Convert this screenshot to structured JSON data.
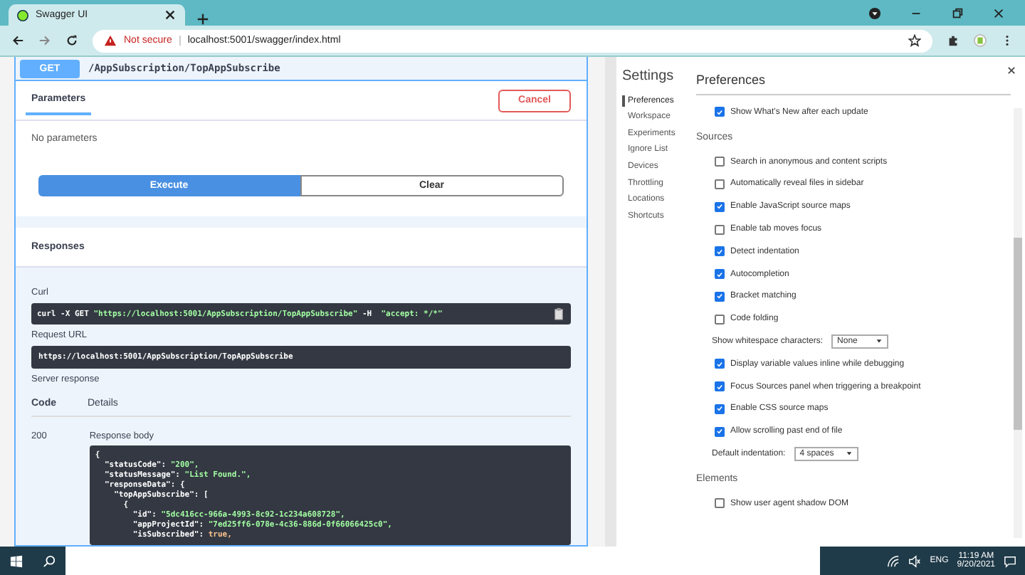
{
  "browser": {
    "tab_title": "Swagger UI",
    "security": "Not secure",
    "url": "localhost:5001/swagger/index.html"
  },
  "operation": {
    "method": "GET",
    "path": "/AppSubscription/TopAppSubscribe",
    "tab": "Parameters",
    "cancel": "Cancel",
    "no_params": "No parameters",
    "execute": "Execute",
    "clear": "Clear",
    "responses_title": "Responses",
    "curl_label": "Curl",
    "curl": [
      {
        "kind": "plain",
        "text": "curl -X GET "
      },
      {
        "kind": "string",
        "text": "\"https://localhost:5001/AppSubscription/TopAppSubscribe\""
      },
      {
        "kind": "plain",
        "text": " -H  "
      },
      {
        "kind": "string",
        "text": "\"accept: */*\""
      }
    ],
    "request_url_label": "Request URL",
    "request_url": "https://localhost:5001/AppSubscription/TopAppSubscribe",
    "server_response": "Server response",
    "columns": [
      "Code",
      "Details"
    ],
    "code": "200",
    "body_label": "Response body",
    "body": [
      {
        "kind": "plain",
        "key": "{"
      },
      {
        "kind": "string",
        "key": "  \"statusCode\": ",
        "value": "\"200\","
      },
      {
        "kind": "string",
        "key": "  \"statusMessage\": ",
        "value": "\"List Found.\","
      },
      {
        "kind": "plain",
        "key": "  \"responseData\": {"
      },
      {
        "kind": "plain",
        "key": "    \"topAppSubscribe\": ["
      },
      {
        "kind": "plain",
        "key": "      {"
      },
      {
        "kind": "string",
        "key": "        \"id\": ",
        "value": "\"5dc416cc-966a-4993-8c92-1c234a608728\","
      },
      {
        "kind": "string",
        "key": "        \"appProjectId\": ",
        "value": "\"7ed25ff6-078e-4c36-886d-0f66066425c0\","
      },
      {
        "kind": "boolean",
        "key": "        \"isSubscribed\": ",
        "value": "true,"
      }
    ]
  },
  "settings": {
    "title": "Settings",
    "heading": "Preferences",
    "nav": [
      {
        "label": "Preferences",
        "selected": true
      },
      {
        "label": "Workspace",
        "selected": false
      },
      {
        "label": "Experiments",
        "selected": false
      },
      {
        "label": "Ignore List",
        "selected": false
      },
      {
        "label": "Devices",
        "selected": false
      },
      {
        "label": "Throttling",
        "selected": false
      },
      {
        "label": "Locations",
        "selected": false
      },
      {
        "label": "Shortcuts",
        "selected": false
      }
    ],
    "items": [
      {
        "kind": "checkbox",
        "label": "Show What's New after each update",
        "checked": true
      },
      {
        "kind": "heading",
        "label": "Sources"
      },
      {
        "kind": "checkbox",
        "label": "Search in anonymous and content scripts",
        "checked": false
      },
      {
        "kind": "checkbox",
        "label": "Automatically reveal files in sidebar",
        "checked": false
      },
      {
        "kind": "checkbox",
        "label": "Enable JavaScript source maps",
        "checked": true
      },
      {
        "kind": "checkbox",
        "label": "Enable tab moves focus",
        "checked": false
      },
      {
        "kind": "checkbox",
        "label": "Detect indentation",
        "checked": true
      },
      {
        "kind": "checkbox",
        "label": "Autocompletion",
        "checked": true
      },
      {
        "kind": "checkbox",
        "label": "Bracket matching",
        "checked": true
      },
      {
        "kind": "checkbox",
        "label": "Code folding",
        "checked": false
      },
      {
        "kind": "select",
        "label": "Show whitespace characters:",
        "value": "None"
      },
      {
        "kind": "checkbox",
        "label": "Display variable values inline while debugging",
        "checked": true
      },
      {
        "kind": "checkbox",
        "label": "Focus Sources panel when triggering a breakpoint",
        "checked": true
      },
      {
        "kind": "checkbox",
        "label": "Enable CSS source maps",
        "checked": true
      },
      {
        "kind": "checkbox",
        "label": "Allow scrolling past end of file",
        "checked": true
      },
      {
        "kind": "select",
        "label": "Default indentation:",
        "value": "4 spaces"
      },
      {
        "kind": "heading",
        "label": "Elements"
      },
      {
        "kind": "checkbox",
        "label": "Show user agent shadow DOM",
        "checked": false
      }
    ]
  },
  "taskbar": {
    "language": "ENG",
    "time": "11:19 AM",
    "date": "9/20/2021"
  }
}
